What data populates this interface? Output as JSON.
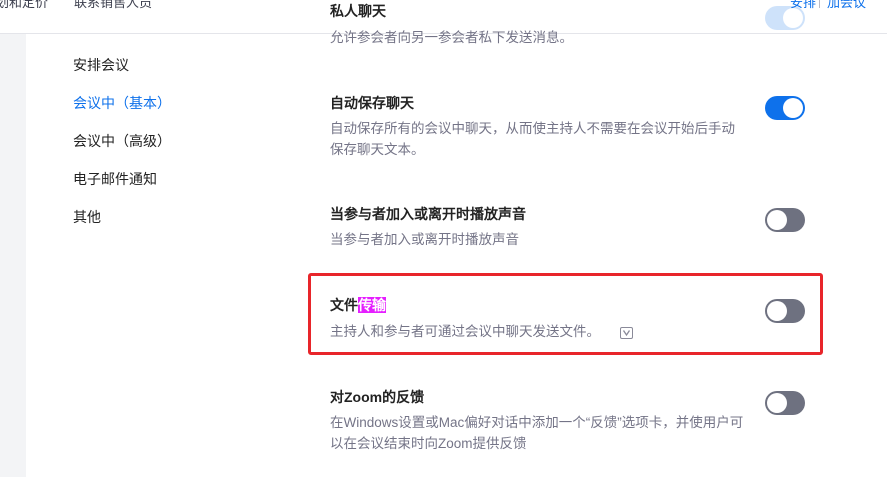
{
  "topbar": {
    "link_left_1": "划和定价",
    "link_left_2": "联系销售人员",
    "link_schedule": "安排",
    "link_join": "加会议"
  },
  "sidebar": {
    "items": [
      {
        "label": "安排会议",
        "active": false
      },
      {
        "label": "会议中（基本）",
        "active": true
      },
      {
        "label": "会议中（高级）",
        "active": false
      },
      {
        "label": "电子邮件通知",
        "active": false
      },
      {
        "label": "其他",
        "active": false
      }
    ]
  },
  "settings": {
    "private_chat": {
      "title": "私人聊天",
      "desc": "允许参会者向另一参会者私下发送消息。",
      "enabled": true
    },
    "auto_save_chat": {
      "title": "自动保存聊天",
      "desc": "自动保存所有的会议中聊天，从而使主持人不需要在会议开始后手动保存聊天文本。",
      "enabled": true
    },
    "join_leave_sound": {
      "title": "当参与者加入或离开时播放声音",
      "desc": "当参与者加入或离开时播放声音",
      "enabled": false
    },
    "file_transfer": {
      "title_prefix": "文件",
      "title_highlight": "传输",
      "desc": "主持人和参与者可通过会议中聊天发送文件。",
      "enabled": false,
      "icon": "video-icon"
    },
    "zoom_feedback": {
      "title": "对Zoom的反馈",
      "desc": "在Windows设置或Mac偏好对话中添加一个“反馈”选项卡，并使用户可以在会议结束时向Zoom提供反馈",
      "enabled": false
    }
  },
  "colors": {
    "accent": "#0e71eb",
    "toggle_off": "#6e7180",
    "annotation_box": "#e8252a",
    "search_highlight": "#e51fff"
  }
}
